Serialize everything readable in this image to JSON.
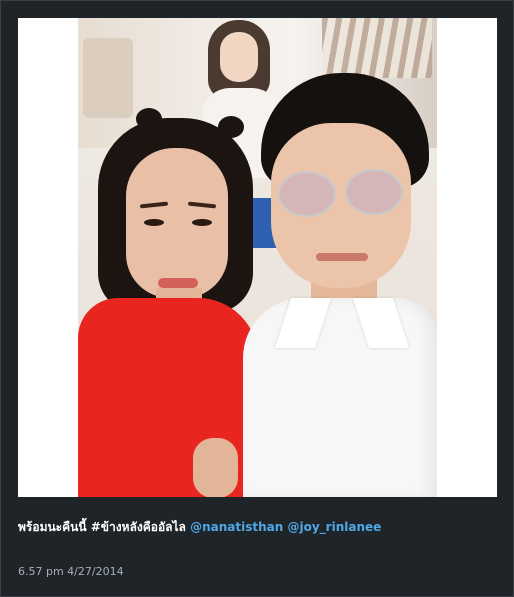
{
  "post": {
    "caption_text": "พร้อมนะคืนนี้ #ข้างหลังคืออัลไล",
    "mentions": [
      "@nanatisthan",
      "@joy_rinlanee"
    ],
    "timestamp": "6.57 pm 4/27/2014"
  },
  "colors": {
    "background": "#1f2428",
    "mention": "#4fa8e8",
    "timestamp": "#a7aeb5"
  }
}
